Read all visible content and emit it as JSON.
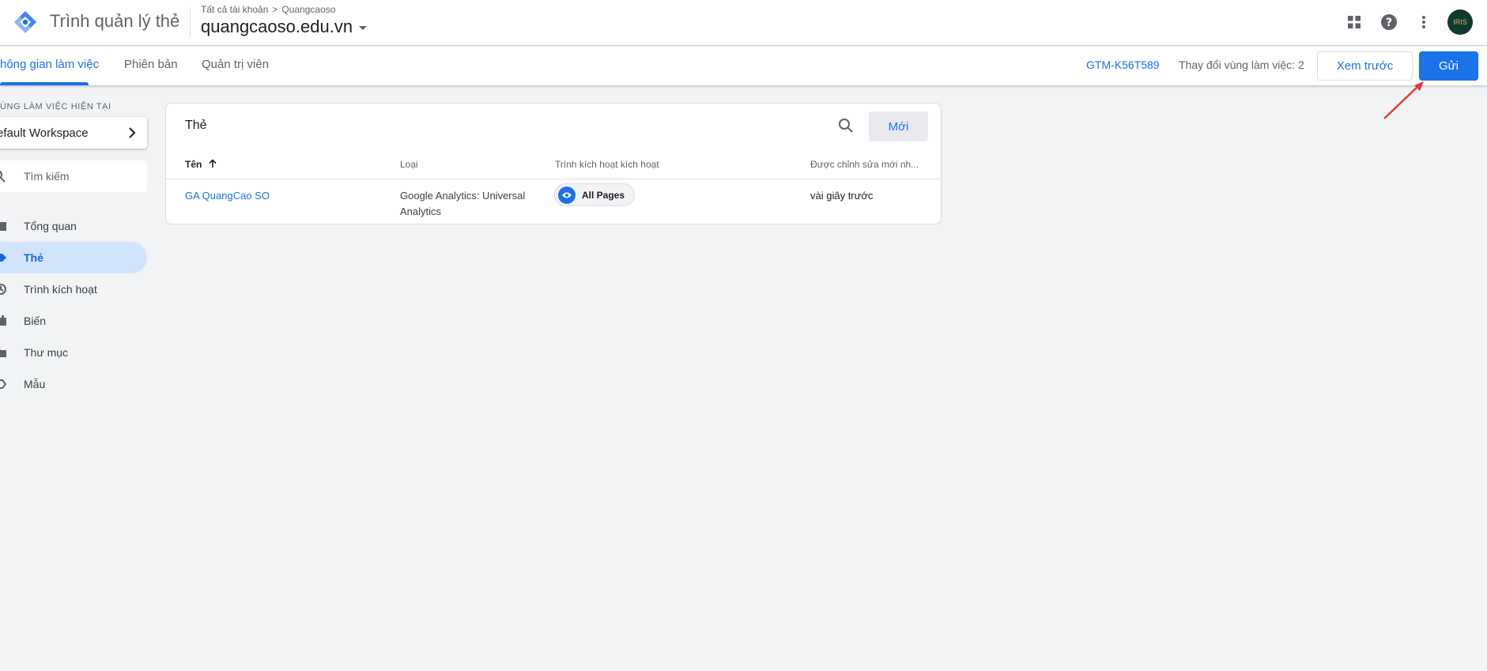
{
  "header": {
    "app_title": "Trình quản lý thẻ",
    "breadcrumb": {
      "root": "Tất cả tài khoản",
      "separator": ">",
      "account": "Quangcaoso"
    },
    "container_name": "quangcaoso.edu.vn",
    "avatar_text": "IRIS"
  },
  "navbar": {
    "tabs": [
      {
        "label": "hông gian làm việc"
      },
      {
        "label": "Phiên bản"
      },
      {
        "label": "Quản trị viên"
      }
    ],
    "container_id": "GTM-K56T589",
    "workspace_changes": "Thay đổi vùng làm việc: 2",
    "preview_label": "Xem trước",
    "submit_label": "Gửi"
  },
  "sidebar": {
    "workspace_label": "ÙNG LÀM VIỆC HIỆN TẠI",
    "workspace_name": "efault Workspace",
    "search_placeholder": "Tìm kiếm",
    "items": [
      {
        "label": "Tổng quan",
        "icon": "overview-icon"
      },
      {
        "label": "Thẻ",
        "icon": "tag-icon"
      },
      {
        "label": "Trình kích hoạt",
        "icon": "trigger-icon"
      },
      {
        "label": "Biến",
        "icon": "variable-icon"
      },
      {
        "label": "Thư mục",
        "icon": "folder-icon"
      },
      {
        "label": "Mẫu",
        "icon": "template-icon"
      }
    ]
  },
  "tags_card": {
    "title": "Thẻ",
    "new_label": "Mới",
    "columns": [
      "Tên",
      "Loại",
      "Trình kích hoạt kích hoạt",
      "Được chỉnh sửa mới nh..."
    ],
    "rows": [
      {
        "name": "GA QuangCao SO",
        "type_line1": "Google Analytics: Universal",
        "type_line2": "Analytics",
        "trigger": "All Pages",
        "edited": "vài giây trước"
      }
    ]
  },
  "colors": {
    "accent": "#1a73e8",
    "active_nav_bg": "#d2e3fc",
    "page_bg": "#f1f3f4",
    "annotation": "#e53935"
  }
}
